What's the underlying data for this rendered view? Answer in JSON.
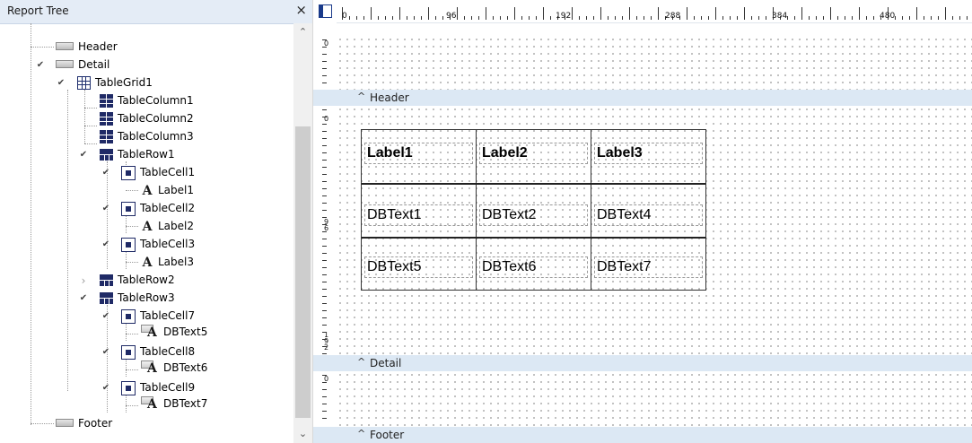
{
  "tree": {
    "title": "Report Tree",
    "close_glyph": "×",
    "scroll_up": "⌃",
    "scroll_down": "⌄",
    "nodes": [
      {
        "label": "Header",
        "icon": "band-icon"
      },
      {
        "label": "Detail",
        "icon": "band-icon",
        "expanded": true
      },
      {
        "label": "TableGrid1",
        "icon": "table-grid-icon",
        "expanded": true
      },
      {
        "label": "TableColumn1",
        "icon": "table-column-icon"
      },
      {
        "label": "TableColumn2",
        "icon": "table-column-icon"
      },
      {
        "label": "TableColumn3",
        "icon": "table-column-icon"
      },
      {
        "label": "TableRow1",
        "icon": "table-row-icon",
        "expanded": true
      },
      {
        "label": "TableCell1",
        "icon": "table-cell-icon",
        "expanded": true
      },
      {
        "label": "Label1",
        "icon": "label-icon"
      },
      {
        "label": "TableCell2",
        "icon": "table-cell-icon",
        "expanded": true
      },
      {
        "label": "Label2",
        "icon": "label-icon"
      },
      {
        "label": "TableCell3",
        "icon": "table-cell-icon",
        "expanded": true
      },
      {
        "label": "Label3",
        "icon": "label-icon"
      },
      {
        "label": "TableRow2",
        "icon": "table-row-icon",
        "expanded": false
      },
      {
        "label": "TableRow3",
        "icon": "table-row-icon",
        "expanded": true
      },
      {
        "label": "TableCell7",
        "icon": "table-cell-icon",
        "expanded": true
      },
      {
        "label": "DBText5",
        "icon": "dbtext-icon"
      },
      {
        "label": "TableCell8",
        "icon": "table-cell-icon",
        "expanded": true
      },
      {
        "label": "DBText6",
        "icon": "dbtext-icon"
      },
      {
        "label": "TableCell9",
        "icon": "table-cell-icon",
        "expanded": true
      },
      {
        "label": "DBText7",
        "icon": "dbtext-icon"
      },
      {
        "label": "Footer",
        "icon": "band-icon"
      }
    ]
  },
  "ruler": {
    "labels": [
      "0",
      "96",
      "192",
      "288",
      "384",
      "480"
    ]
  },
  "bands": {
    "header": {
      "caret": "^",
      "name": "Header",
      "ruler": [
        "0"
      ]
    },
    "detail": {
      "caret": "^",
      "name": "Detail",
      "ruler": [
        "0",
        "9",
        "6",
        "1",
        "9",
        "2"
      ]
    },
    "footer": {
      "caret": "^",
      "name": "Footer",
      "ruler": [
        "0"
      ]
    }
  },
  "grid": {
    "rows": [
      [
        "Label1",
        "Label2",
        "Label3"
      ],
      [
        "DBText1",
        "DBText2",
        "DBText4"
      ],
      [
        "DBText5",
        "DBText6",
        "DBText7"
      ]
    ]
  },
  "colors": {
    "band_bar": "#dce8f4",
    "panel_header": "#e4ecf6",
    "tree_icon_blue": "#1f2a66"
  }
}
